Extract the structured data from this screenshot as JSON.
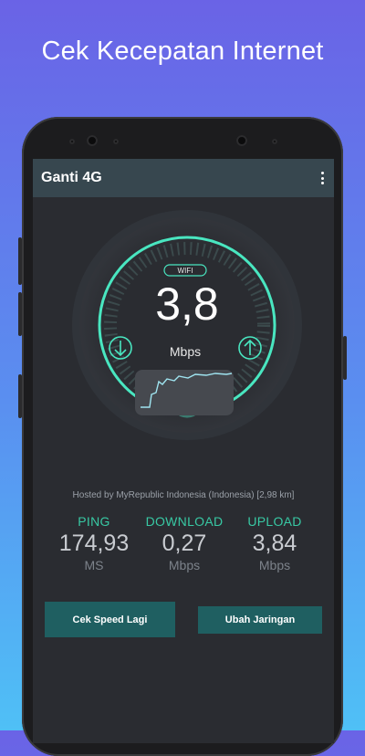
{
  "headline": "Cek Kecepatan Internet",
  "app": {
    "title": "Ganti 4G"
  },
  "gauge": {
    "network_badge": "WIFI",
    "speed": "3,8",
    "unit": "Mbps"
  },
  "hosted_by": "Hosted by MyRepublic Indonesia (Indonesia) [2,98 km]",
  "metrics": [
    {
      "label": "PING",
      "value": "174,93",
      "unit": "MS"
    },
    {
      "label": "DOWNLOAD",
      "value": "0,27",
      "unit": "Mbps"
    },
    {
      "label": "UPLOAD",
      "value": "3,84",
      "unit": "Mbps"
    }
  ],
  "buttons": {
    "retest": "Cek Speed Lagi",
    "change_network": "Ubah Jaringan"
  },
  "colors": {
    "accent": "#38c9a4",
    "appbar": "#37474f",
    "button": "#1f5f61"
  },
  "icons": {
    "download": "arrow-down-circle-icon",
    "upload": "arrow-up-circle-icon",
    "menu": "more-vert-icon"
  }
}
